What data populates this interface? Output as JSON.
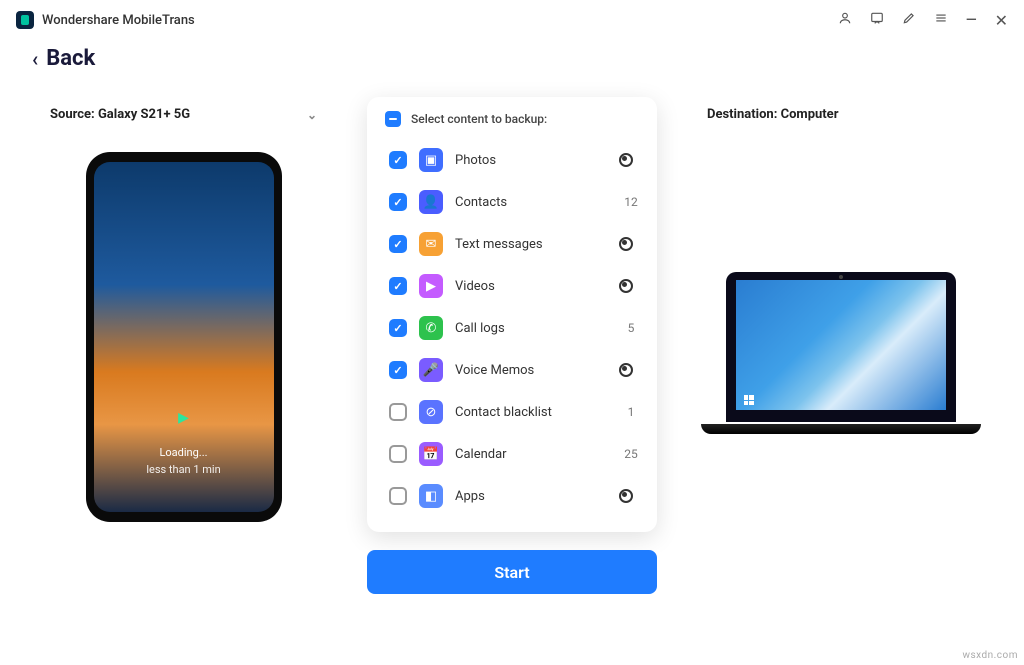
{
  "app": {
    "title": "Wondershare MobileTrans"
  },
  "nav": {
    "back": "Back"
  },
  "source": {
    "label": "Source: Galaxy S21+ 5G",
    "loading": "Loading...",
    "eta": "less than 1 min"
  },
  "destination": {
    "label": "Destination: Computer"
  },
  "panel": {
    "title": "Select content to backup:"
  },
  "items": [
    {
      "label": "Photos",
      "checked": true,
      "count": null,
      "loading": true,
      "bg": "#3f6eff",
      "glyph": "▣"
    },
    {
      "label": "Contacts",
      "checked": true,
      "count": "12",
      "loading": false,
      "bg": "#4a5dff",
      "glyph": "👤"
    },
    {
      "label": "Text messages",
      "checked": true,
      "count": null,
      "loading": true,
      "bg": "#f7a134",
      "glyph": "✉"
    },
    {
      "label": "Videos",
      "checked": true,
      "count": null,
      "loading": true,
      "bg": "#c45bff",
      "glyph": "▶"
    },
    {
      "label": "Call logs",
      "checked": true,
      "count": "5",
      "loading": false,
      "bg": "#2dc24d",
      "glyph": "✆"
    },
    {
      "label": "Voice Memos",
      "checked": true,
      "count": null,
      "loading": true,
      "bg": "#7a5cff",
      "glyph": "🎤"
    },
    {
      "label": "Contact blacklist",
      "checked": false,
      "count": "1",
      "loading": false,
      "bg": "#5a73ff",
      "glyph": "⊘"
    },
    {
      "label": "Calendar",
      "checked": false,
      "count": "25",
      "loading": false,
      "bg": "#9a5cff",
      "glyph": "📅"
    },
    {
      "label": "Apps",
      "checked": false,
      "count": null,
      "loading": true,
      "bg": "#5a8cff",
      "glyph": "◧"
    }
  ],
  "actions": {
    "start": "Start"
  },
  "watermark": "wsxdn.com"
}
